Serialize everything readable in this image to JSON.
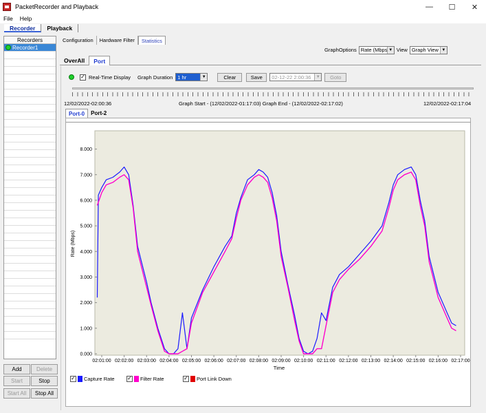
{
  "window": {
    "title": "PacketRecorder and Playback",
    "minimize": "—",
    "maximize": "☐",
    "close": "✕"
  },
  "menu": [
    "File",
    "Help"
  ],
  "main_tabs": [
    "Recorder",
    "Playback"
  ],
  "left_panel": {
    "header": "Recorders",
    "selected_item": "Recorder1"
  },
  "buttons": {
    "add": "Add",
    "delete": "Delete",
    "start": "Start",
    "stop": "Stop",
    "start_all": "Start All",
    "stop_all": "Stop All"
  },
  "sub_tabs": [
    "Configuration",
    "Hardware Filter",
    "Statistics"
  ],
  "graph_options": {
    "label": "GraphOptions",
    "value": "Rate (Mbps)",
    "view_label": "View",
    "view_value": "Graph View"
  },
  "port_tabs": [
    "OverAll",
    "Port"
  ],
  "controls": {
    "realtime_label": "Real-Time Display",
    "duration_label": "Graph Duration",
    "duration_value": "1 hr",
    "clear": "Clear",
    "save": "Save",
    "datetime": "02-12-22   2:00:36",
    "goto": "Goto"
  },
  "time_info": {
    "left": "12/02/2022-02:00:36",
    "center": "Graph Start - (12/02/2022-01:17:03) Graph End - (12/02/2022-02:17:02)",
    "right": "12/02/2022-02:17:04"
  },
  "port_sub_tabs": [
    "Port-0",
    "Port-2"
  ],
  "legend": [
    {
      "label": "Capture Rate",
      "color": "#1a1aff"
    },
    {
      "label": "Filter Rate",
      "color": "#ff00cc"
    },
    {
      "label": "Port Link Down",
      "color": "#e00000"
    }
  ],
  "chart_data": {
    "type": "line",
    "ylabel": "Rate (Mbps)",
    "xlabel": "Time",
    "ylim": [
      0,
      8.5
    ],
    "yticks": [
      "0.000",
      "1.000",
      "2.000",
      "3.000",
      "4.000",
      "5.000",
      "6.000",
      "7.000",
      "8.000"
    ],
    "xlim": [
      0,
      16
    ],
    "xticks": [
      "02:01:00",
      "02:02:00",
      "02:03:00",
      "02:04:00",
      "02:05:00",
      "02:06:00",
      "02:07:00",
      "02:08:00",
      "02:09:00",
      "02:10:00",
      "02:11:00",
      "02:12:00",
      "02:13:00",
      "02:14:00",
      "02:15:00",
      "02:16:00",
      "02:17:00"
    ],
    "series": [
      {
        "name": "Capture Rate",
        "color": "#1a1aff",
        "x": [
          -0.2,
          -0.15,
          0.0,
          0.2,
          0.5,
          0.8,
          1.0,
          1.2,
          1.4,
          1.6,
          1.8,
          2.0,
          2.2,
          2.5,
          2.8,
          3.0,
          3.2,
          3.4,
          3.6,
          3.8,
          4.0,
          4.5,
          5.0,
          5.5,
          5.8,
          6.0,
          6.2,
          6.5,
          6.8,
          7.0,
          7.2,
          7.4,
          7.6,
          7.8,
          8.0,
          8.3,
          8.6,
          8.8,
          9.0,
          9.2,
          9.4,
          9.6,
          9.8,
          10.0,
          10.3,
          10.6,
          11.0,
          11.5,
          12.0,
          12.5,
          12.8,
          13.0,
          13.2,
          13.5,
          13.8,
          14.0,
          14.2,
          14.4,
          14.6,
          14.8,
          15.0,
          15.2,
          15.4,
          15.6,
          15.8
        ],
        "y": [
          2.2,
          6.2,
          6.5,
          6.8,
          6.9,
          7.1,
          7.3,
          7.0,
          5.8,
          4.2,
          3.5,
          2.8,
          2.0,
          1.0,
          0.2,
          0.0,
          0.0,
          0.2,
          1.6,
          0.2,
          1.4,
          2.5,
          3.4,
          4.2,
          4.6,
          5.5,
          6.1,
          6.8,
          7.0,
          7.2,
          7.1,
          6.9,
          6.3,
          5.4,
          4.0,
          2.7,
          1.5,
          0.6,
          0.1,
          0.0,
          0.1,
          0.6,
          1.6,
          1.3,
          2.6,
          3.1,
          3.4,
          3.9,
          4.4,
          5.0,
          5.9,
          6.6,
          7.0,
          7.2,
          7.3,
          7.0,
          6.0,
          5.2,
          3.8,
          3.1,
          2.4,
          2.0,
          1.6,
          1.2,
          1.1
        ]
      },
      {
        "name": "Filter Rate",
        "color": "#ff00cc",
        "x": [
          -0.2,
          0.0,
          0.2,
          0.5,
          0.8,
          1.0,
          1.2,
          1.4,
          1.6,
          1.8,
          2.0,
          2.2,
          2.5,
          2.8,
          3.0,
          3.2,
          3.4,
          3.6,
          3.8,
          4.0,
          4.5,
          5.0,
          5.5,
          5.8,
          6.0,
          6.2,
          6.5,
          6.8,
          7.0,
          7.2,
          7.4,
          7.6,
          7.8,
          8.0,
          8.3,
          8.6,
          8.8,
          9.0,
          9.2,
          9.4,
          9.6,
          9.8,
          10.0,
          10.3,
          10.6,
          11.0,
          11.5,
          12.0,
          12.5,
          12.8,
          13.0,
          13.2,
          13.5,
          13.8,
          14.0,
          14.2,
          14.4,
          14.6,
          14.8,
          15.0,
          15.2,
          15.4,
          15.6,
          15.8
        ],
        "y": [
          5.8,
          6.3,
          6.6,
          6.7,
          6.9,
          7.0,
          6.8,
          5.7,
          4.0,
          3.3,
          2.6,
          1.9,
          0.9,
          0.1,
          0.0,
          0.0,
          0.0,
          0.1,
          0.2,
          1.2,
          2.4,
          3.2,
          4.0,
          4.5,
          5.3,
          6.0,
          6.6,
          6.9,
          7.0,
          6.9,
          6.7,
          6.1,
          5.2,
          3.8,
          2.6,
          1.3,
          0.5,
          0.0,
          0.0,
          0.0,
          0.2,
          0.2,
          1.1,
          2.4,
          2.9,
          3.3,
          3.7,
          4.2,
          4.8,
          5.7,
          6.4,
          6.8,
          7.0,
          7.1,
          6.8,
          5.8,
          5.0,
          3.6,
          2.9,
          2.2,
          1.8,
          1.4,
          1.0,
          0.9
        ]
      }
    ]
  }
}
